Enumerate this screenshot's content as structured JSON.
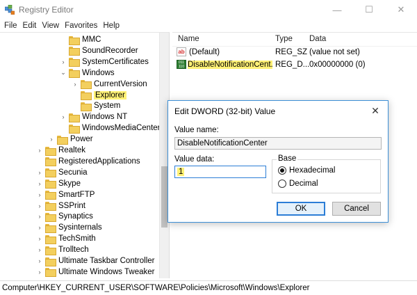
{
  "window": {
    "title": "Registry Editor",
    "minimize": "—",
    "maximize": "☐",
    "close": "✕"
  },
  "menu": [
    "File",
    "Edit",
    "View",
    "Favorites",
    "Help"
  ],
  "tree": [
    {
      "label": "MMC",
      "depth": 2,
      "expander": ""
    },
    {
      "label": "SoundRecorder",
      "depth": 2,
      "expander": ""
    },
    {
      "label": "SystemCertificates",
      "depth": 2,
      "expander": ">"
    },
    {
      "label": "Windows",
      "depth": 2,
      "expander": "v"
    },
    {
      "label": "CurrentVersion",
      "depth": 3,
      "expander": ">"
    },
    {
      "label": "Explorer",
      "depth": 3,
      "expander": "",
      "selected": true
    },
    {
      "label": "System",
      "depth": 3,
      "expander": ""
    },
    {
      "label": "Windows NT",
      "depth": 2,
      "expander": ">"
    },
    {
      "label": "WindowsMediaCenter",
      "depth": 2,
      "expander": ""
    },
    {
      "label": "Power",
      "depth": 1,
      "expander": ">"
    },
    {
      "label": "Realtek",
      "depth": 0,
      "expander": ">"
    },
    {
      "label": "RegisteredApplications",
      "depth": 0,
      "expander": ""
    },
    {
      "label": "Secunia",
      "depth": 0,
      "expander": ">"
    },
    {
      "label": "Skype",
      "depth": 0,
      "expander": ">"
    },
    {
      "label": "SmartFTP",
      "depth": 0,
      "expander": ">"
    },
    {
      "label": "SSPrint",
      "depth": 0,
      "expander": ">"
    },
    {
      "label": "Synaptics",
      "depth": 0,
      "expander": ">"
    },
    {
      "label": "Sysinternals",
      "depth": 0,
      "expander": ">"
    },
    {
      "label": "TechSmith",
      "depth": 0,
      "expander": ">"
    },
    {
      "label": "Trolltech",
      "depth": 0,
      "expander": ">"
    },
    {
      "label": "Ultimate Taskbar Controller",
      "depth": 0,
      "expander": ">"
    },
    {
      "label": "Ultimate Windows Tweaker",
      "depth": 0,
      "expander": ">"
    }
  ],
  "list": {
    "headers": {
      "name": "Name",
      "type": "Type",
      "data": "Data"
    },
    "rows": [
      {
        "icon": "ab",
        "icon_text": "ab",
        "name": "(Default)",
        "type": "REG_SZ",
        "data": "(value not set)",
        "highlight": false
      },
      {
        "icon": "bin",
        "icon_text": "011 110",
        "name": "DisableNotificationCent...",
        "type": "REG_D...",
        "data": "0x00000000 (0)",
        "highlight": true
      }
    ]
  },
  "status": {
    "path": "Computer\\HKEY_CURRENT_USER\\SOFTWARE\\Policies\\Microsoft\\Windows\\Explorer"
  },
  "dialog": {
    "title": "Edit DWORD (32-bit) Value",
    "close": "✕",
    "value_name_label": "Value name:",
    "value_name": "DisableNotificationCenter",
    "value_data_label": "Value data:",
    "value_data": "1",
    "base_label": "Base",
    "hex_label": "Hexadecimal",
    "dec_label": "Decimal",
    "ok_label": "OK",
    "cancel_label": "Cancel"
  },
  "colors": {
    "highlight": "#fff176",
    "accent": "#2b7dd6",
    "folder": "#f3cf5e"
  }
}
